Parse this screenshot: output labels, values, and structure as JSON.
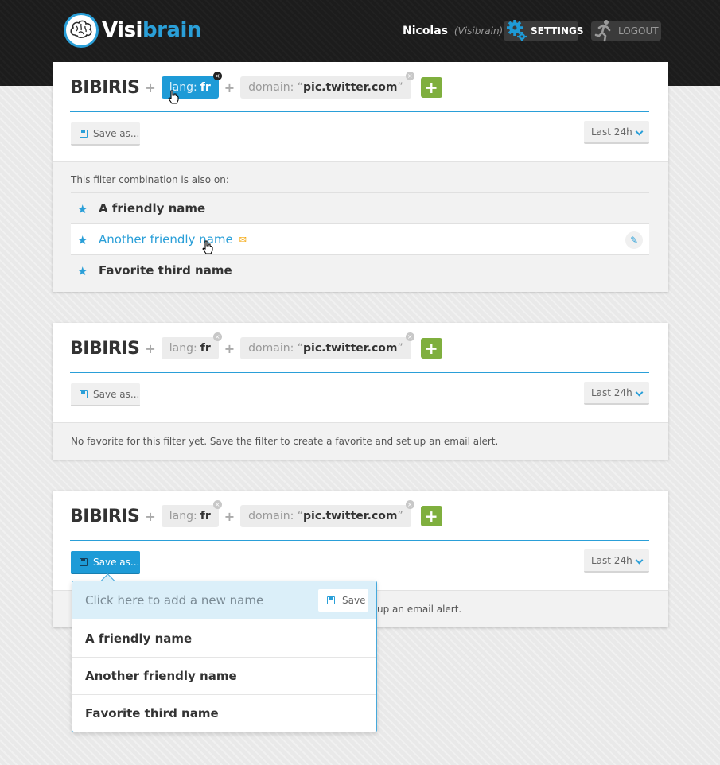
{
  "header": {
    "logo_prefix": "Visi",
    "logo_suffix": "brain",
    "user_name": "Nicolas",
    "user_org": "(Visibrain)",
    "settings_label": "SETTINGS",
    "logout_label": "LOGOUT"
  },
  "cards": [
    {
      "title": "BIBIRIS",
      "filters": [
        {
          "key": "lang:",
          "value": "fr",
          "active": true
        },
        {
          "key": "domain: “",
          "value": "pic.twitter.com",
          "suffix": "”",
          "active": false
        }
      ],
      "save_label": "Save as...",
      "time_label": "Last 24h",
      "note": "This filter combination is also on:",
      "favorites": [
        {
          "name": "A friendly name"
        },
        {
          "name": "Another friendly name",
          "highlighted": true
        },
        {
          "name": "Favorite third name"
        }
      ]
    },
    {
      "title": "BIBIRIS",
      "filters": [
        {
          "key": "lang:",
          "value": "fr",
          "active": false
        },
        {
          "key": "domain: “",
          "value": "pic.twitter.com",
          "suffix": "”",
          "active": false
        }
      ],
      "save_label": "Save as...",
      "time_label": "Last 24h",
      "message": "No favorite for this filter yet. Save the filter to create a favorite and set up an email alert."
    },
    {
      "title": "BIBIRIS",
      "filters": [
        {
          "key": "lang:",
          "value": "fr",
          "active": false
        },
        {
          "key": "domain: “",
          "value": "pic.twitter.com",
          "suffix": "”",
          "active": false
        }
      ],
      "save_label": "Save as...",
      "time_label": "Last 24h",
      "message_visible": "up an email alert."
    }
  ],
  "save_dropdown": {
    "placeholder": "Click here to add a new name",
    "save_label": "Save",
    "items": [
      "A friendly name",
      "Another friendly name",
      "Favorite third name"
    ]
  },
  "colors": {
    "accent": "#1e9bd7",
    "add_button": "#7faf3e",
    "mail_icon": "#f4a300",
    "topbar": "#1c1c1c"
  },
  "icons": {
    "filter_remove": "×",
    "add": "+",
    "favorite": "★",
    "mail": "✉",
    "edit": "✎"
  }
}
